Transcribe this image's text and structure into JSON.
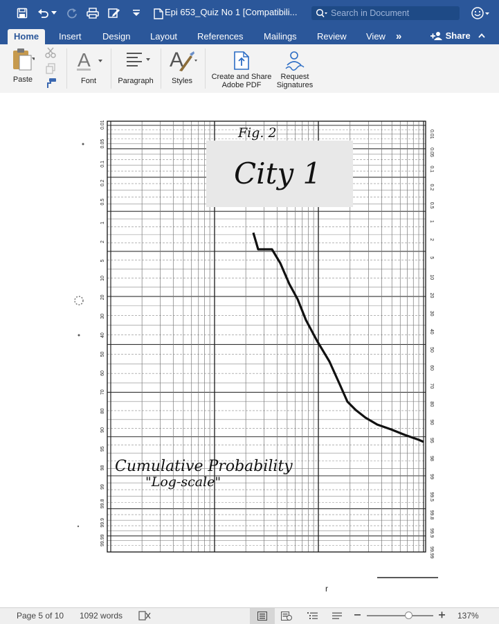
{
  "titlebar": {
    "document_title": "Epi 653_Quiz No 1 [Compatibili...",
    "search_placeholder": "Search in Document",
    "bg_color": "#2b579a"
  },
  "tabs": [
    {
      "label": "Home",
      "active": true
    },
    {
      "label": "Insert"
    },
    {
      "label": "Design"
    },
    {
      "label": "Layout"
    },
    {
      "label": "References"
    },
    {
      "label": "Mailings"
    },
    {
      "label": "Review"
    },
    {
      "label": "View"
    }
  ],
  "tabs_more_label": "»",
  "share_label": "Share",
  "ribbon": {
    "paste_label": "Paste",
    "font_label": "Font",
    "paragraph_label": "Paragraph",
    "styles_label": "Styles",
    "pdf_label_line1": "Create and Share",
    "pdf_label_line2": "Adobe PDF",
    "signatures_label_line1": "Request",
    "signatures_label_line2": "Signatures"
  },
  "document": {
    "figure_label": "Fig. 2",
    "city_label": "City 1",
    "annotation_line1": "Cumulative Probability",
    "annotation_line2": "\"Log-scale\"",
    "left_axis_labels": [
      "99.99",
      "99.9",
      "99.8",
      "99",
      "98",
      "95",
      "90",
      "80",
      "70",
      "60",
      "50",
      "40",
      "30",
      "20",
      "10",
      "5",
      "2",
      "1",
      "0.5",
      "0.2",
      "0.1",
      "0.05",
      "0.01"
    ],
    "right_axis_labels": [
      "99.99",
      "99.9",
      "99.8",
      "99.5",
      "99",
      "98",
      "95",
      "90",
      "80",
      "70",
      "60",
      "50",
      "40",
      "30",
      "20",
      "10",
      "5",
      "2",
      "1",
      "0.5",
      "0.2",
      "0.1",
      "0.05",
      "0.01"
    ],
    "footer_mark": "r"
  },
  "statusbar": {
    "page_info": "Page 5 of 10",
    "word_count": "1092 words",
    "zoom_level": "137%",
    "zoom_fraction": 0.63
  }
}
